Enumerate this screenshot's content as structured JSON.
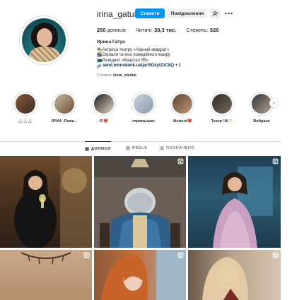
{
  "profile": {
    "username": "irina_gatun",
    "follow_label": "Стежити",
    "message_label": "Повідомлення",
    "full_name": "Ирина Гатун",
    "bio_lines": [
      "🎭Актриса театру «Чорний квадрат»",
      "🎬Серіали та кіно комедійного жанру",
      "📺Резидент «Квартал 95»"
    ],
    "link_text": "send.monobank.ua/jar/5GkytZzC8Q + 1",
    "followed_by_prefix": "Стежить ",
    "followed_by_user": "lesia_nikituk"
  },
  "stats": {
    "posts_count": "250",
    "posts_label": " дописів",
    "followers_label": "Читачі: ",
    "followers_count": "39,3 тис.",
    "following_label": "Стежить: ",
    "following_count": "326"
  },
  "highlights": [
    {
      "label": "🙏🏻🙏🏻🙏🏻",
      "colors": [
        "#8b5a3c",
        "#3a2a22"
      ]
    },
    {
      "label": "ІРІХА -Пова...",
      "colors": [
        "#c9b8a2",
        "#6e4f3a"
      ]
    },
    {
      "label": "Я ❤️",
      "colors": [
        "#1a1a1a",
        "#e8d7c7"
      ]
    },
    {
      "label": "«примьера»",
      "colors": [
        "#c9d3dc",
        "#8a9aa8"
      ]
    },
    {
      "label": "Фемелі❤️",
      "colors": [
        "#5a4030",
        "#c49a78"
      ]
    },
    {
      "label": "Театр ЧК🫶🏻",
      "colors": [
        "#2a2a2a",
        "#7a6a5a"
      ]
    },
    {
      "label": "Вибране",
      "colors": [
        "#333333",
        "#b0a090"
      ]
    }
  ],
  "tabs": [
    {
      "label": "ДОПИСИ",
      "icon": "grid-icon",
      "active": true
    },
    {
      "label": "REELS",
      "icon": "reels-icon",
      "active": false
    },
    {
      "label": "ПОЗНАЧЕНО",
      "icon": "tagged-icon",
      "active": false
    }
  ],
  "colors": {
    "accent": "#0095f6",
    "text": "#262626",
    "muted": "#737373",
    "link": "#00376b",
    "border": "#dbdbdb"
  }
}
